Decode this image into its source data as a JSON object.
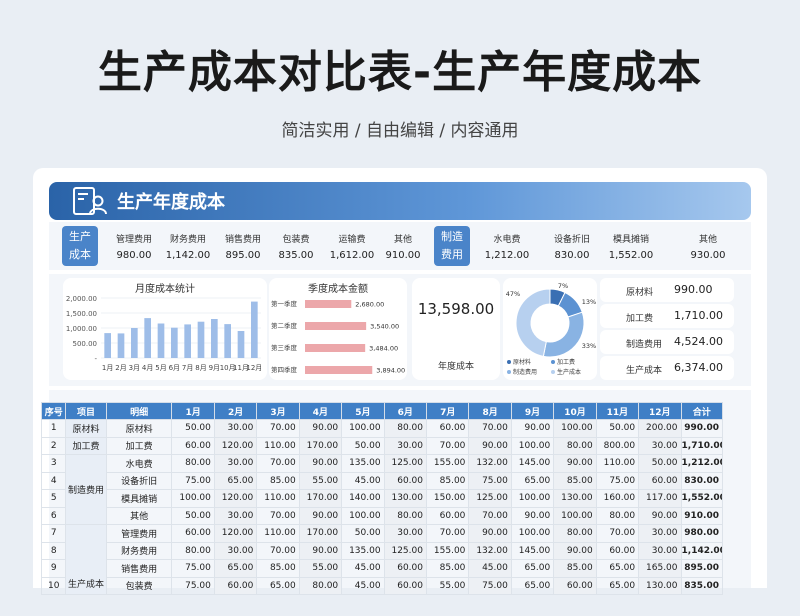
{
  "page": {
    "title": "生产成本对比表-生产年度成本",
    "subtitle": "简洁实用 / 自由编辑 / 内容通用",
    "banner_title": "生产年度成本"
  },
  "kpi": {
    "group1": {
      "tag": [
        "生产",
        "成本"
      ],
      "items": [
        {
          "label": "管理费用",
          "value": "980.00"
        },
        {
          "label": "财务费用",
          "value": "1,142.00"
        },
        {
          "label": "销售费用",
          "value": "895.00"
        },
        {
          "label": "包装费",
          "value": "835.00"
        },
        {
          "label": "运输费",
          "value": "1,612.00"
        },
        {
          "label": "其他",
          "value": "910.00"
        }
      ]
    },
    "group2": {
      "tag": [
        "制造",
        "费用"
      ],
      "items": [
        {
          "label": "水电费",
          "value": "1,212.00"
        },
        {
          "label": "设备折旧",
          "value": "830.00"
        },
        {
          "label": "模具摊销",
          "value": "1,552.00"
        },
        {
          "label": "其他",
          "value": "930.00"
        }
      ]
    }
  },
  "charts": {
    "total": {
      "value": "13,598.00",
      "label": "年度成本"
    }
  },
  "chart_data": [
    {
      "type": "bar",
      "title": "月度成本统计",
      "categories": [
        "1月",
        "2月",
        "3月",
        "4月",
        "5月",
        "6月",
        "7月",
        "8月",
        "9月",
        "10月",
        "11月",
        "12月"
      ],
      "values": [
        830,
        820,
        1000,
        1330,
        1150,
        1010,
        1120,
        1210,
        1300,
        1130,
        900,
        1880
      ],
      "ylim": [
        0,
        2000
      ],
      "yticks": [
        "2,000.00",
        "1,500.00",
        "1,000.00",
        "500.00",
        "-"
      ],
      "ytick_values": [
        2000,
        1500,
        1000,
        500,
        0
      ],
      "color": "#9ebde8"
    },
    {
      "type": "bar",
      "orientation": "horizontal",
      "title": "季度成本金额",
      "categories": [
        "第一季度",
        "第二季度",
        "第三季度",
        "第四季度"
      ],
      "values": [
        2680,
        3540,
        3484,
        3894
      ],
      "labels": [
        "2,680.00",
        "3,540.00",
        "3,484.00",
        "3,894.00"
      ],
      "xlim": [
        0,
        4400
      ],
      "color": "#e58a8e"
    },
    {
      "type": "pie",
      "categories": [
        "原材料",
        "加工费",
        "制造费用",
        "生产成本"
      ],
      "values": [
        990,
        1710,
        4524,
        6374
      ],
      "labels": [
        "7%",
        "13%",
        "33%",
        "47%"
      ],
      "colors": [
        "#3a6fb3",
        "#5c92d2",
        "#89b3e3",
        "#b7d0ef"
      ],
      "legend": "bottom"
    }
  ],
  "right_summary": [
    {
      "label": "原材料",
      "value": "990.00"
    },
    {
      "label": "加工费",
      "value": "1,710.00"
    },
    {
      "label": "制造费用",
      "value": "4,524.00"
    },
    {
      "label": "生产成本",
      "value": "6,374.00"
    }
  ],
  "table": {
    "headers": [
      "序号",
      "项目",
      "明细",
      "1月",
      "2月",
      "3月",
      "4月",
      "5月",
      "6月",
      "7月",
      "8月",
      "9月",
      "10月",
      "11月",
      "12月",
      "合计"
    ],
    "rows": [
      {
        "no": "1",
        "project": "原材料",
        "detail": "原材料",
        "values": [
          "50.00",
          "30.00",
          "70.00",
          "90.00",
          "100.00",
          "80.00",
          "60.00",
          "70.00",
          "90.00",
          "100.00",
          "50.00",
          "200.00"
        ],
        "total": "990.00"
      },
      {
        "no": "2",
        "project": "加工费",
        "detail": "加工费",
        "values": [
          "60.00",
          "120.00",
          "110.00",
          "170.00",
          "50.00",
          "30.00",
          "70.00",
          "90.00",
          "100.00",
          "80.00",
          "800.00",
          "30.00"
        ],
        "total": "1,710.00"
      },
      {
        "no": "3",
        "project": "",
        "detail": "水电费",
        "values": [
          "80.00",
          "30.00",
          "70.00",
          "90.00",
          "135.00",
          "125.00",
          "155.00",
          "132.00",
          "145.00",
          "90.00",
          "110.00",
          "50.00"
        ],
        "total": "1,212.00"
      },
      {
        "no": "4",
        "project": "",
        "detail": "设备折旧",
        "values": [
          "75.00",
          "65.00",
          "85.00",
          "55.00",
          "45.00",
          "60.00",
          "85.00",
          "75.00",
          "65.00",
          "85.00",
          "75.00",
          "60.00"
        ],
        "total": "830.00"
      },
      {
        "no": "5",
        "project": "",
        "detail": "模具摊销",
        "values": [
          "100.00",
          "120.00",
          "110.00",
          "170.00",
          "140.00",
          "130.00",
          "150.00",
          "125.00",
          "100.00",
          "130.00",
          "160.00",
          "117.00"
        ],
        "total": "1,552.00"
      },
      {
        "no": "6",
        "project": "",
        "detail": "其他",
        "values": [
          "50.00",
          "30.00",
          "70.00",
          "90.00",
          "100.00",
          "80.00",
          "60.00",
          "70.00",
          "90.00",
          "100.00",
          "80.00",
          "90.00"
        ],
        "total": "910.00"
      },
      {
        "no": "7",
        "project": "",
        "detail": "管理费用",
        "values": [
          "60.00",
          "120.00",
          "110.00",
          "170.00",
          "50.00",
          "30.00",
          "70.00",
          "90.00",
          "100.00",
          "80.00",
          "70.00",
          "30.00"
        ],
        "total": "980.00"
      },
      {
        "no": "8",
        "project": "",
        "detail": "财务费用",
        "values": [
          "80.00",
          "30.00",
          "70.00",
          "90.00",
          "135.00",
          "125.00",
          "155.00",
          "132.00",
          "145.00",
          "90.00",
          "60.00",
          "30.00"
        ],
        "total": "1,142.00"
      },
      {
        "no": "9",
        "project": "",
        "detail": "销售费用",
        "values": [
          "75.00",
          "65.00",
          "85.00",
          "55.00",
          "45.00",
          "60.00",
          "85.00",
          "45.00",
          "65.00",
          "85.00",
          "65.00",
          "165.00"
        ],
        "total": "895.00"
      },
      {
        "no": "10",
        "project": "",
        "detail": "包装费",
        "values": [
          "75.00",
          "60.00",
          "65.00",
          "80.00",
          "45.00",
          "60.00",
          "55.00",
          "75.00",
          "65.00",
          "60.00",
          "65.00",
          "130.00"
        ],
        "total": "835.00"
      }
    ],
    "groups": [
      {
        "label": "制造费用"
      },
      {
        "label": "生产成本"
      }
    ]
  }
}
